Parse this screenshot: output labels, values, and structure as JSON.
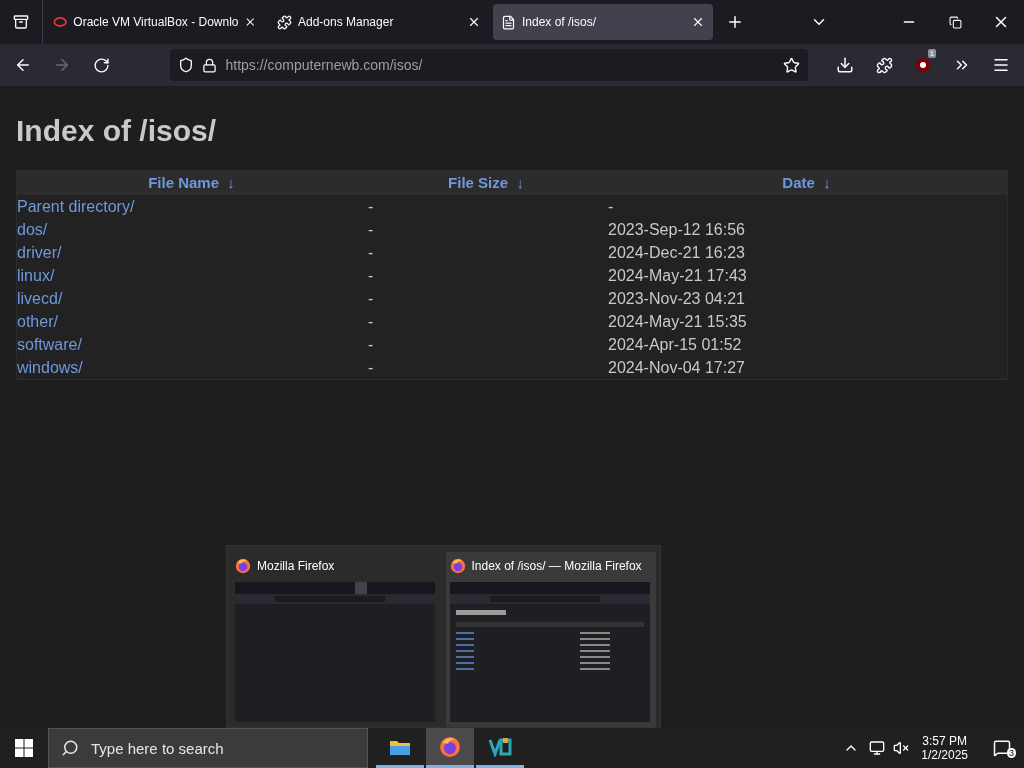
{
  "tabs": [
    {
      "label": "Oracle VM VirtualBox - Downlo",
      "selected": false
    },
    {
      "label": "Add-ons Manager",
      "selected": false
    },
    {
      "label": "Index of /isos/",
      "selected": true
    }
  ],
  "toolbar": {
    "forward_disabled": true,
    "url_host": "https://computernewb.com",
    "url_path": "/isos/",
    "extension_badge": "1"
  },
  "page": {
    "title": "Index of /isos/",
    "columns": [
      "File Name  ↓",
      "File Size  ↓",
      "Date  ↓"
    ],
    "rows": [
      {
        "name": "Parent directory/",
        "size": "-",
        "date": "-"
      },
      {
        "name": "dos/",
        "size": "-",
        "date": "2023-Sep-12 16:56"
      },
      {
        "name": "driver/",
        "size": "-",
        "date": "2024-Dec-21 16:23"
      },
      {
        "name": "linux/",
        "size": "-",
        "date": "2024-May-21 17:43"
      },
      {
        "name": "livecd/",
        "size": "-",
        "date": "2023-Nov-23 04:21"
      },
      {
        "name": "other/",
        "size": "-",
        "date": "2024-May-21 15:35"
      },
      {
        "name": "software/",
        "size": "-",
        "date": "2024-Apr-15 01:52"
      },
      {
        "name": "windows/",
        "size": "-",
        "date": "2024-Nov-04 17:27"
      }
    ]
  },
  "previews": [
    {
      "title": "Mozilla Firefox",
      "kind": "blank",
      "selected": false
    },
    {
      "title": "Index of /isos/ — Mozilla Firefox",
      "kind": "listing",
      "selected": true
    }
  ],
  "taskbar": {
    "search_placeholder": "Type here to search",
    "apps": [
      {
        "kind": "folder",
        "selected": false
      },
      {
        "kind": "firefox",
        "selected": true
      },
      {
        "kind": "vm",
        "selected": false
      }
    ],
    "time": "3:57 PM",
    "date": "1/2/2025",
    "notifications": "3"
  }
}
